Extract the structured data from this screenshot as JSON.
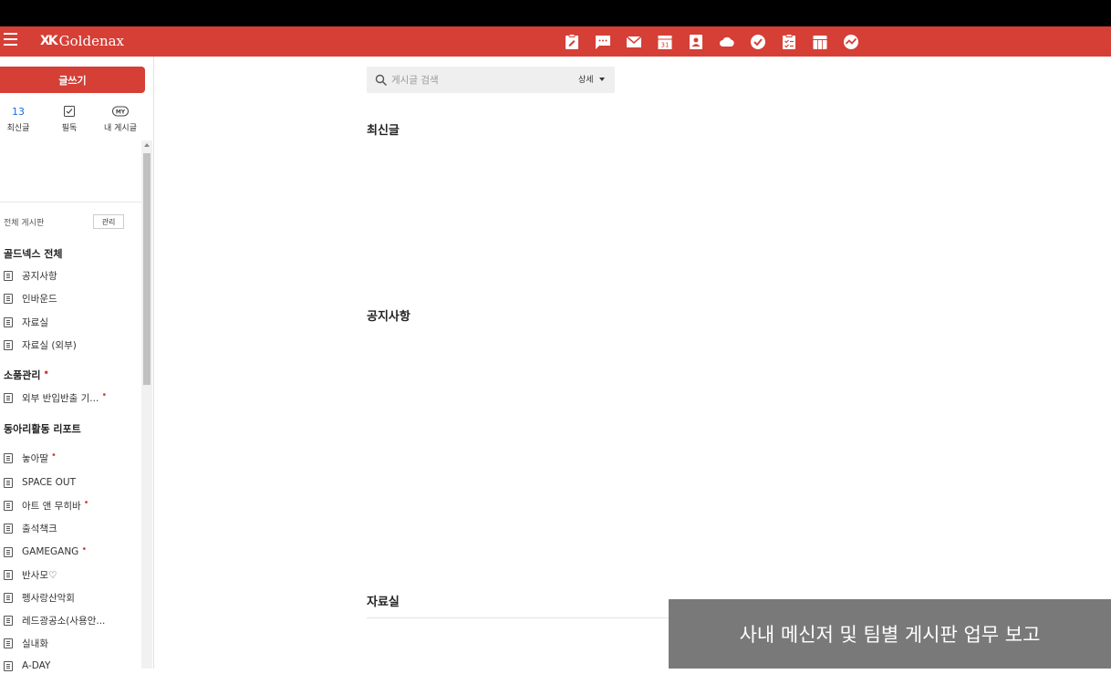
{
  "header": {
    "logo_mark": "XK",
    "logo_text": "Goldenax",
    "apps": [
      {
        "name": "board-icon",
        "title": "게시판"
      },
      {
        "name": "messenger-icon",
        "title": "메신저"
      },
      {
        "name": "mail-icon",
        "title": "메일"
      },
      {
        "name": "calendar-icon",
        "title": "캘린더",
        "day": "31"
      },
      {
        "name": "contacts-icon",
        "title": "주소록"
      },
      {
        "name": "cloud-icon",
        "title": "자료실"
      },
      {
        "name": "todo-icon",
        "title": "할일"
      },
      {
        "name": "approval-icon",
        "title": "전자결재"
      },
      {
        "name": "schedule-icon",
        "title": "일정"
      },
      {
        "name": "report-icon",
        "title": "보고"
      }
    ]
  },
  "sidebar": {
    "write_label": "글쓰기",
    "quick": {
      "recent": {
        "count": "13",
        "label": "최신글"
      },
      "mustread": {
        "label": "필독"
      },
      "my": {
        "badge": "MY",
        "label": "내 게시글"
      }
    },
    "all_boards_label": "전체 게시판",
    "manage_label": "관리",
    "groups": [
      {
        "title": "골드넥스 전체",
        "items": [
          "공지사항",
          "인바운드",
          "자료실",
          "자료실 (외부)"
        ]
      },
      {
        "title": "소품관리",
        "items": [
          "외부 반입반출 기..."
        ]
      },
      {
        "title": "동아리활동 리포트",
        "items": [
          "놓아딸",
          "SPACE OUT",
          "아트 앤 무히바",
          "출석책크",
          "GAMEGANG",
          "반사모♡",
          "펭사랑산악회",
          "레드광공소(사용안...",
          "실내화",
          "A-DAY"
        ]
      }
    ]
  },
  "search": {
    "placeholder": "게시글 검색",
    "detail_label": "상세"
  },
  "main": {
    "sections": [
      "최신글",
      "공지사항",
      "자료실"
    ]
  },
  "caption": "사내 메신저 및 팀별 게시판 업무 보고"
}
